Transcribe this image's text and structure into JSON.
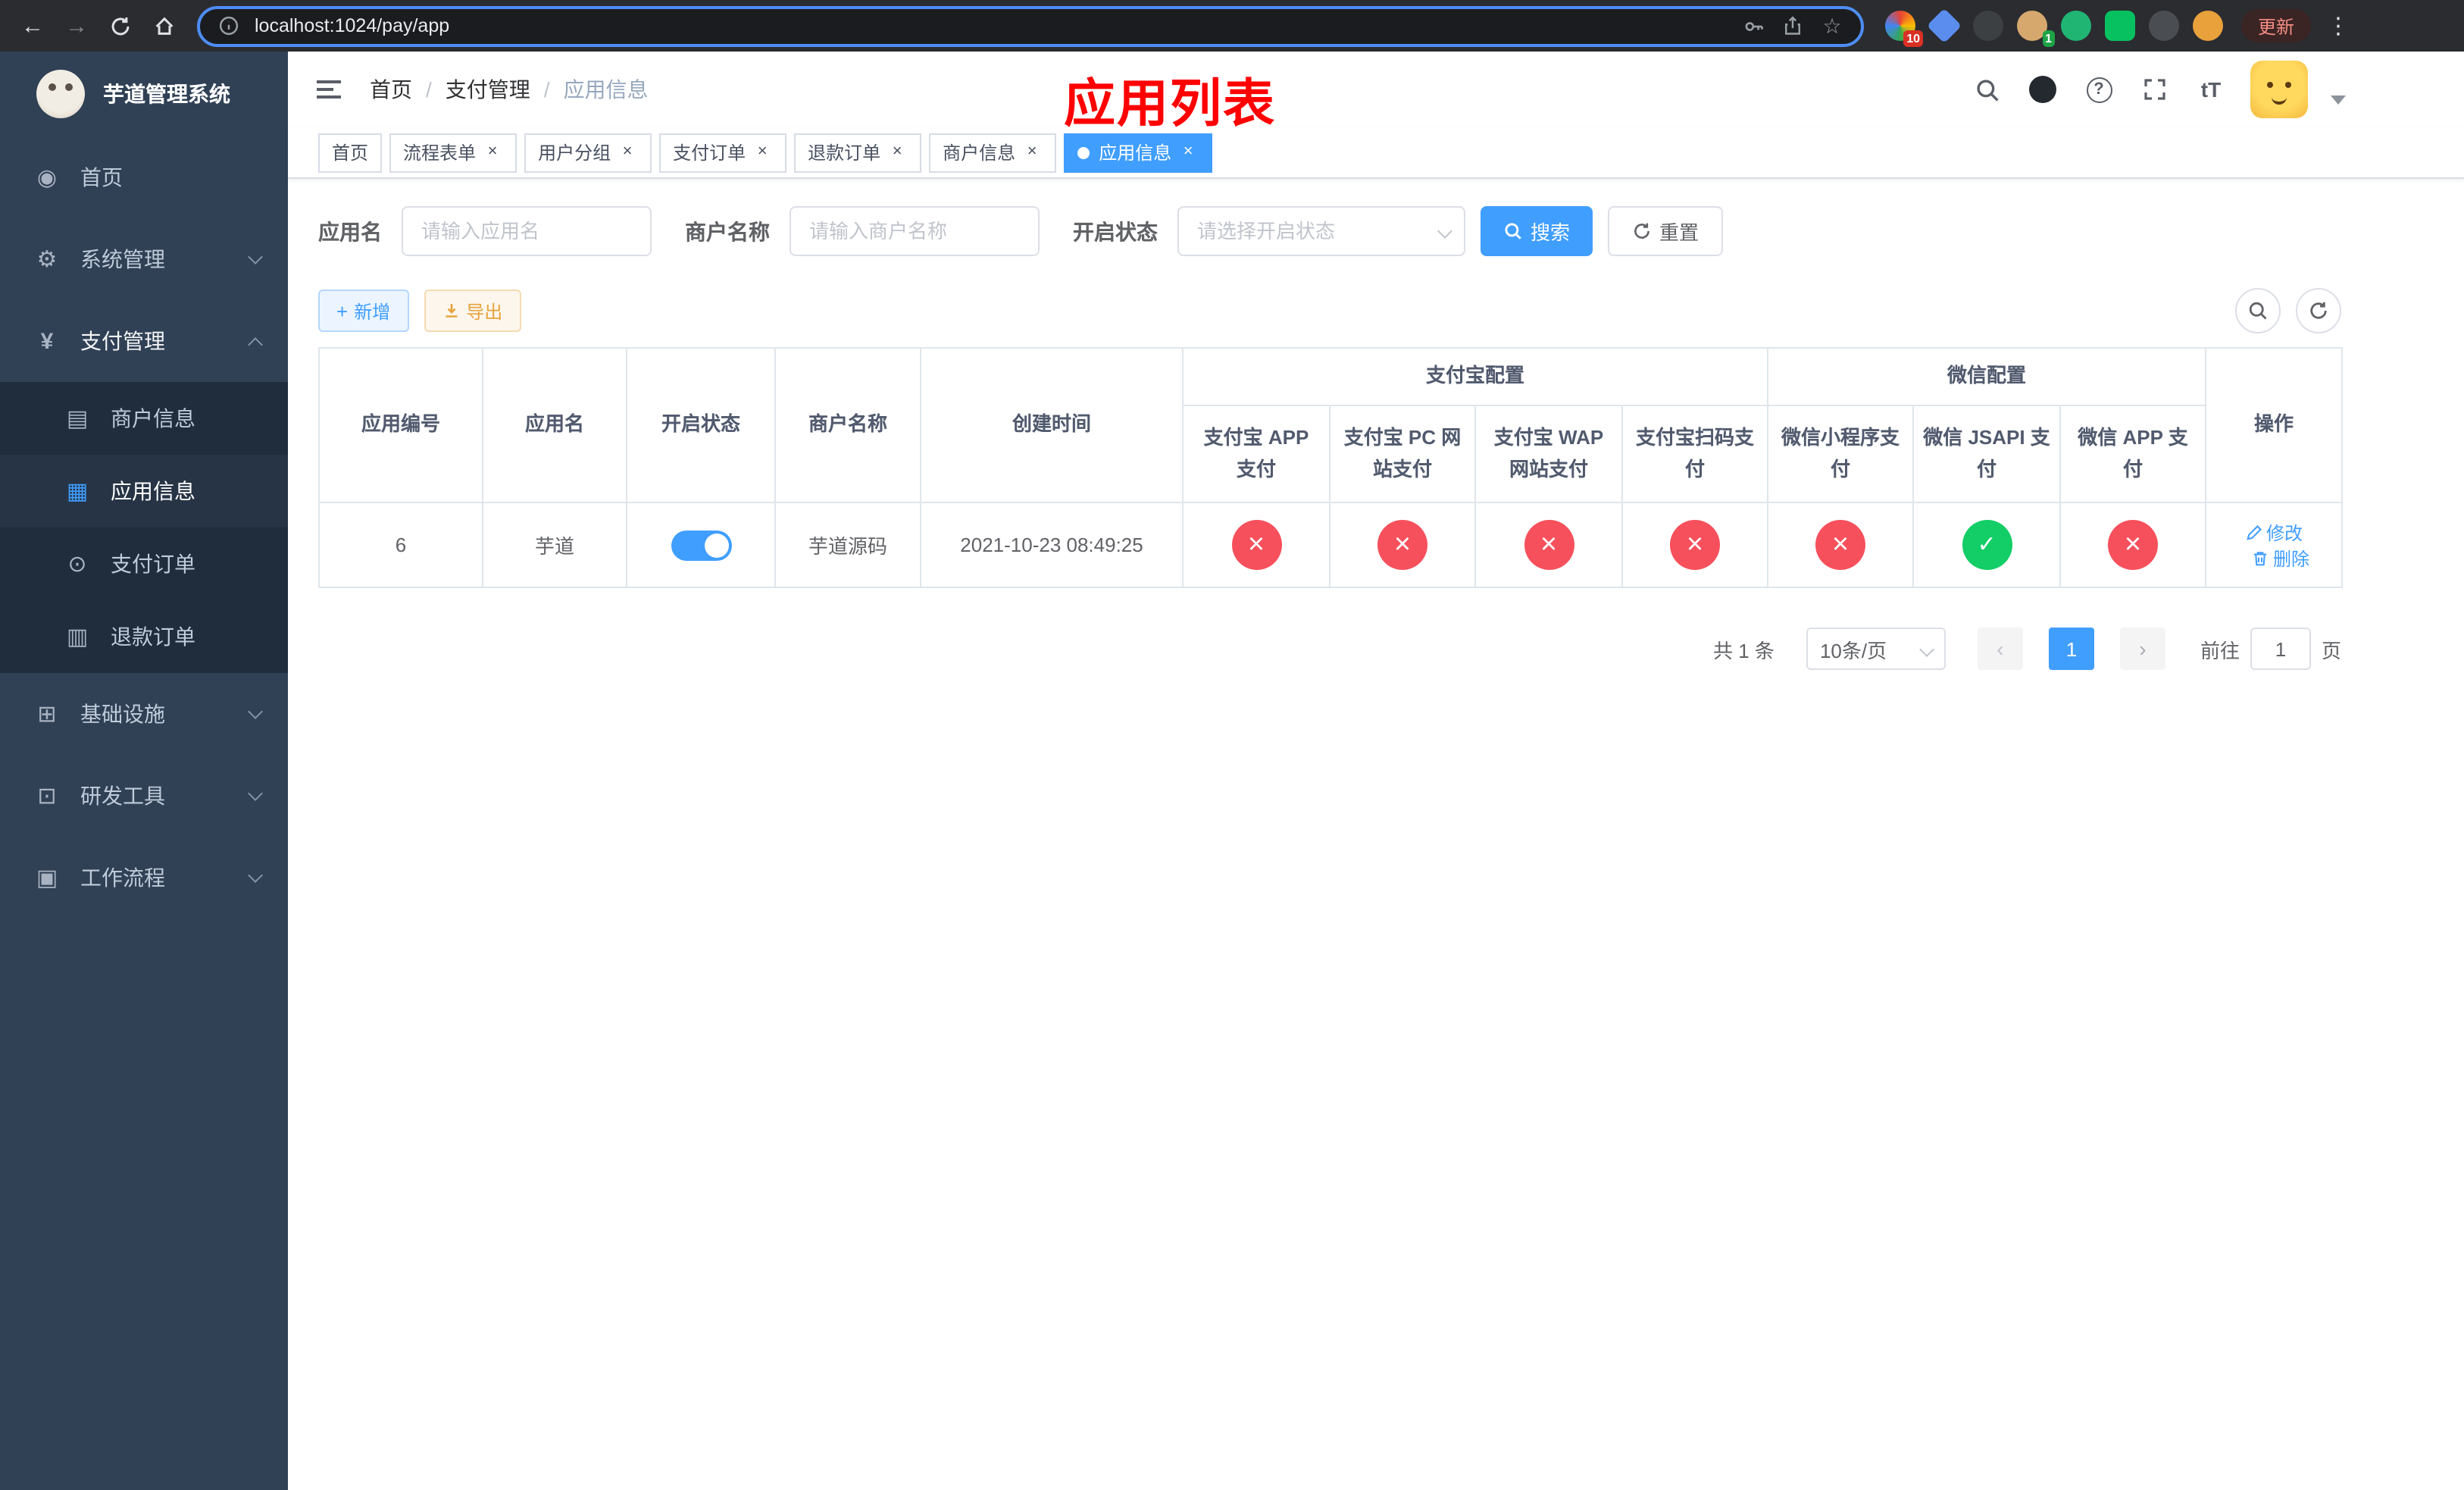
{
  "colors": {
    "accent": "#409eff",
    "success": "#13ce66",
    "danger": "#f6505c",
    "warning": "#e6a23c",
    "sidebar_bg": "#304156",
    "submenu_bg": "#1f2d3d"
  },
  "browser": {
    "url": "localhost:1024/pay/app",
    "update_label": "更新",
    "ext_badge_a": "10",
    "ext_badge_b": "1"
  },
  "sidebar": {
    "logo_title": "芋道管理系统",
    "home": "首页",
    "system": "系统管理",
    "payment": "支付管理",
    "merchant_info": "商户信息",
    "app_info": "应用信息",
    "payment_order": "支付订单",
    "refund_order": "退款订单",
    "infrastructure": "基础设施",
    "dev_tools": "研发工具",
    "workflow": "工作流程"
  },
  "header": {
    "breadcrumb": [
      "首页",
      "支付管理",
      "应用信息"
    ],
    "annotation": "应用列表"
  },
  "tabs": [
    {
      "label": "首页"
    },
    {
      "label": "流程表单"
    },
    {
      "label": "用户分组"
    },
    {
      "label": "支付订单"
    },
    {
      "label": "退款订单"
    },
    {
      "label": "商户信息"
    },
    {
      "label": "应用信息"
    }
  ],
  "filters": {
    "app_name_label": "应用名",
    "app_name_placeholder": "请输入应用名",
    "merchant_label": "商户名称",
    "merchant_placeholder": "请输入商户名称",
    "status_label": "开启状态",
    "status_placeholder": "请选择开启状态",
    "search_label": "搜索",
    "reset_label": "重置"
  },
  "toolbar": {
    "add_label": "新增",
    "export_label": "导出"
  },
  "table": {
    "columns": {
      "id": "应用编号",
      "name": "应用名",
      "status": "开启状态",
      "merchant": "商户名称",
      "created": "创建时间",
      "alipay_group": "支付宝配置",
      "wechat_group": "微信配置",
      "actions": "操作"
    },
    "sub_columns": {
      "alipay_app": "支付宝 APP 支付",
      "alipay_pc": "支付宝 PC 网站支付",
      "alipay_wap": "支付宝 WAP 网站支付",
      "alipay_qr": "支付宝扫码支付",
      "wx_mini": "微信小程序支付",
      "wx_jsapi": "微信 JSAPI 支付",
      "wx_app": "微信 APP 支付"
    },
    "row": {
      "id": "6",
      "name": "芋道",
      "merchant": "芋道源码",
      "created": "2021-10-23 08:49:25",
      "configs": [
        "error",
        "error",
        "error",
        "error",
        "error",
        "success",
        "error"
      ],
      "edit": "修改",
      "delete": "删除"
    }
  },
  "pagination": {
    "total": "共 1 条",
    "page_size": "10条/页",
    "page": "1",
    "goto_label": "前往",
    "goto_value": "1",
    "page_suffix": "页"
  }
}
